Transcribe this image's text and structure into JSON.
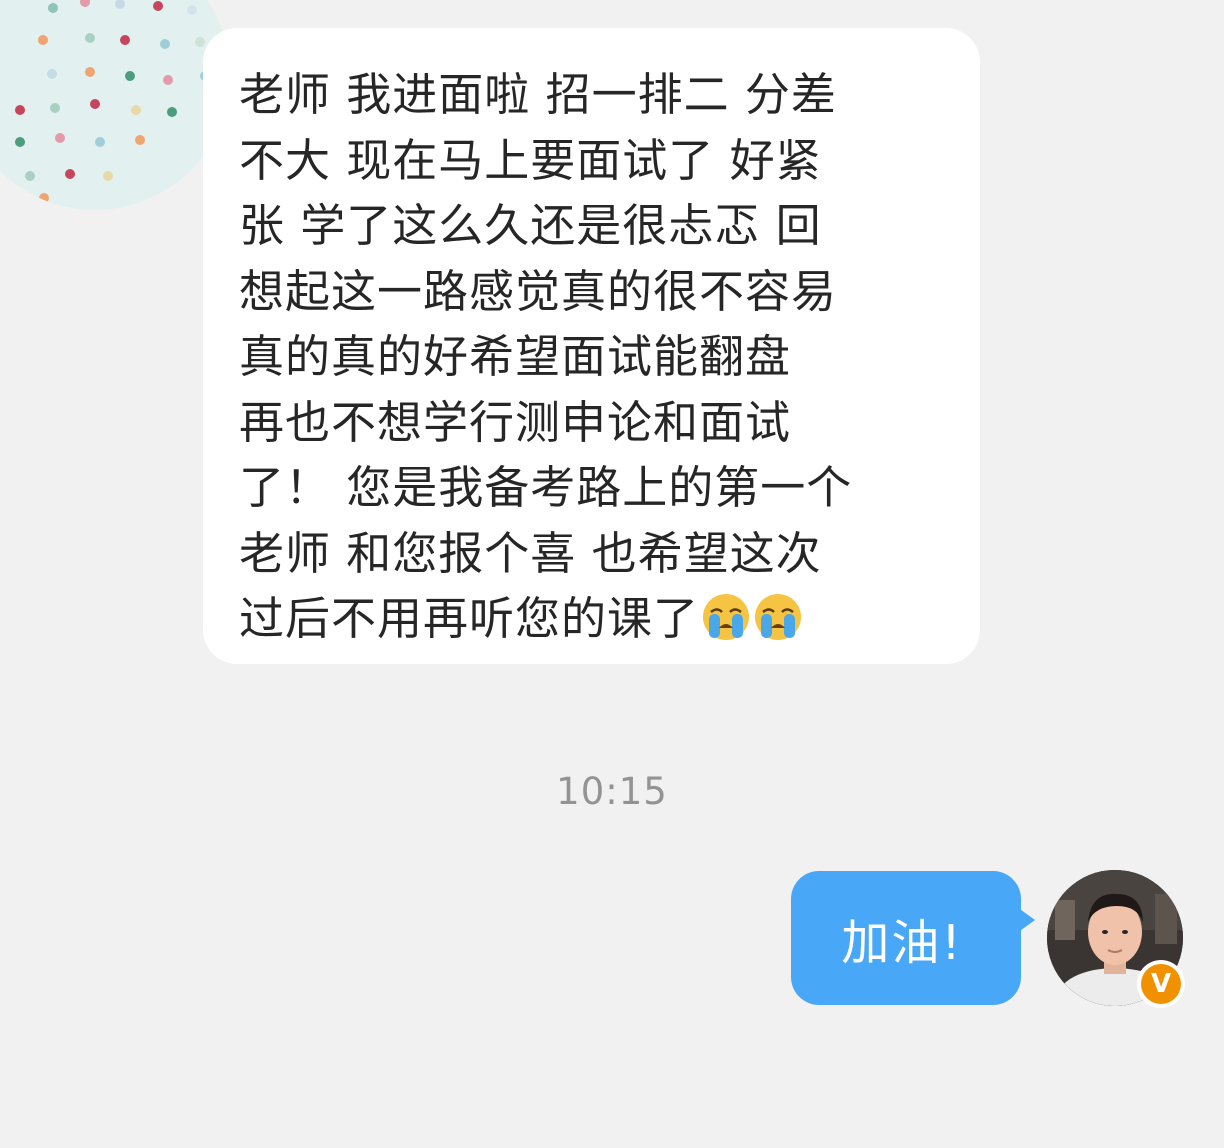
{
  "conversation": {
    "incoming": {
      "text_lines": [
        "老师 我进面啦 招一排二 分差",
        "不大 现在马上要面试了 好紧",
        "张 学了这么久还是很忐忑 回",
        "想起这一路感觉真的很不容易",
        "真的真的好希望面试能翻盘",
        "再也不想学行测申论和面试",
        "了！ 您是我备考路上的第一个",
        "老师 和您报个喜 也希望这次",
        "过后不用再听您的课了"
      ],
      "emoji": [
        "loudly-crying-face-icon",
        "loudly-crying-face-icon"
      ]
    },
    "timestamp": "10:15",
    "outgoing": {
      "text": "加油!"
    }
  },
  "badges": {
    "verified_symbol": "V",
    "verified_color": "#f29100"
  },
  "colors": {
    "background": "#f1f1f1",
    "incoming_bubble": "#ffffff",
    "outgoing_bubble": "#49a7f7",
    "timestamp": "#939393"
  }
}
